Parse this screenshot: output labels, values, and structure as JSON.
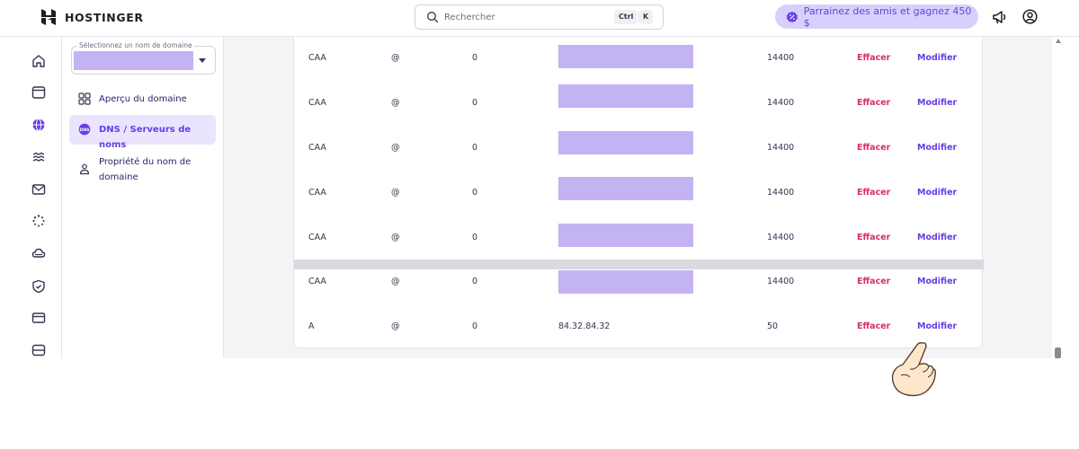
{
  "header": {
    "brand": "HOSTINGER",
    "search": {
      "placeholder": "Rechercher",
      "shortcut_ctrl": "Ctrl",
      "shortcut_key": "K"
    },
    "referral_label": "Parrainez des amis et gagnez 450 $"
  },
  "rail": {
    "icons": [
      "home-icon",
      "browser-window-icon",
      "globe-icon",
      "stack-icon",
      "mail-icon",
      "loader-icon",
      "cloud-icon",
      "shield-icon",
      "card-icon",
      "server-icon"
    ],
    "active_index": 2
  },
  "panel": {
    "domain_select_label": "Sélectionnez un nom de domaine",
    "nav": [
      {
        "label": "Aperçu du domaine",
        "icon": "grid-icon",
        "active": false
      },
      {
        "label": "DNS / Serveurs de noms",
        "icon": "dns-icon",
        "active": true
      },
      {
        "label": "Propriété du nom de domaine",
        "icon": "person-icon",
        "active": false
      }
    ]
  },
  "dns_records": [
    {
      "type": "CAA",
      "name": "@",
      "priority": "0",
      "content": "",
      "ttl": "14400",
      "delete": "Effacer",
      "edit": "Modifier"
    },
    {
      "type": "CAA",
      "name": "@",
      "priority": "0",
      "content": "",
      "ttl": "14400",
      "delete": "Effacer",
      "edit": "Modifier"
    },
    {
      "type": "CAA",
      "name": "@",
      "priority": "0",
      "content": "",
      "ttl": "14400",
      "delete": "Effacer",
      "edit": "Modifier"
    },
    {
      "type": "CAA",
      "name": "@",
      "priority": "0",
      "content": "",
      "ttl": "14400",
      "delete": "Effacer",
      "edit": "Modifier"
    },
    {
      "type": "CAA",
      "name": "@",
      "priority": "0",
      "content": "",
      "ttl": "14400",
      "delete": "Effacer",
      "edit": "Modifier"
    },
    {
      "type": "CAA",
      "name": "@",
      "priority": "0",
      "content": "",
      "ttl": "14400",
      "delete": "Effacer",
      "edit": "Modifier"
    },
    {
      "type": "A",
      "name": "@",
      "priority": "0",
      "content": "84.32.84.32",
      "ttl": "50",
      "delete": "Effacer",
      "edit": "Modifier"
    }
  ],
  "colors": {
    "accent": "#673de6",
    "delete": "#d63163",
    "redaction": "#c3b3f3",
    "active_nav_bg": "#ebe4ff"
  }
}
